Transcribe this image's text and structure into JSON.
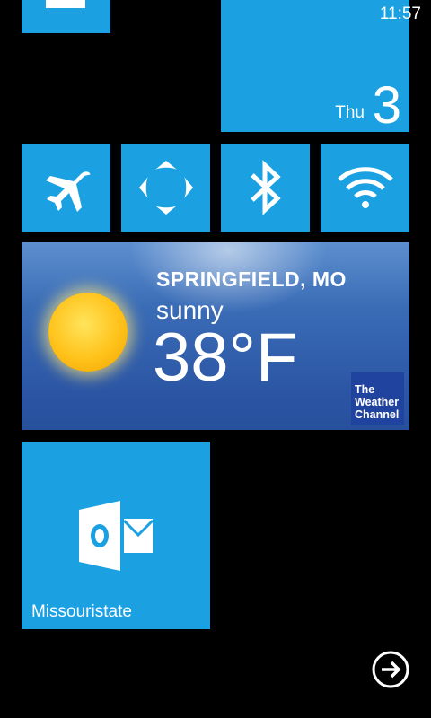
{
  "status_bar": {
    "time": "11:57"
  },
  "calendar": {
    "day": "Thu",
    "date": "3"
  },
  "quick_settings": [
    {
      "icon": "airplane-icon"
    },
    {
      "icon": "rotation-lock-icon"
    },
    {
      "icon": "bluetooth-icon"
    },
    {
      "icon": "wifi-icon"
    }
  ],
  "weather": {
    "city": "SPRINGFIELD, MO",
    "condition": "sunny",
    "temperature": "38°F",
    "provider_logo": [
      "The",
      "Weather",
      "Channel"
    ]
  },
  "outlook": {
    "label": "Missouristate",
    "icon": "outlook-icon"
  },
  "nav": {
    "icon": "arrow-right-circle-icon"
  },
  "colors": {
    "accent": "#1ba1e2",
    "background": "#000000",
    "weather_logo": "#2143a0"
  }
}
